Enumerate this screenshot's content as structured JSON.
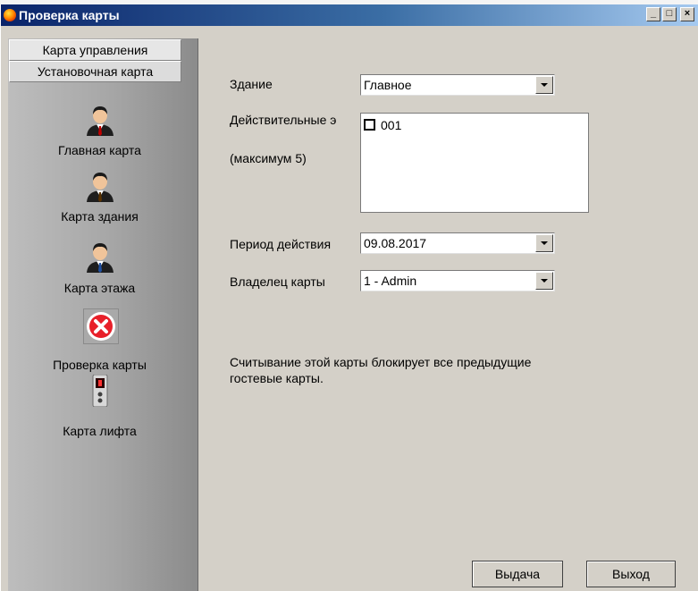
{
  "window": {
    "title": "Проверка карты",
    "minimize": "_",
    "maximize": "□",
    "close": "×"
  },
  "sidebar": {
    "tabs": [
      {
        "label": "Карта управления"
      },
      {
        "label": "Установочная карта"
      }
    ],
    "items": [
      {
        "label": "Главная карта",
        "icon": "person-red-tie-icon",
        "tie_color": "#c00000"
      },
      {
        "label": "Карта здания",
        "icon": "person-brown-tie-icon",
        "tie_color": "#5a3200"
      },
      {
        "label": "Карта этажа",
        "icon": "person-blue-tie-icon",
        "tie_color": "#1f4fa0"
      },
      {
        "label": "Проверка карты",
        "icon": "error-x-icon",
        "selected": true
      },
      {
        "label": "Карта лифта",
        "icon": "elevator-panel-icon"
      }
    ]
  },
  "form": {
    "building_label": "Здание",
    "building_value": "Главное",
    "floors_label": "Действительные э",
    "floors_max": "(максимум 5)",
    "floors": [
      {
        "label": "001",
        "checked": false
      }
    ],
    "period_label": "Период действия",
    "period_value": "09.08.2017",
    "owner_label": "Владелец карты",
    "owner_value": "1 - Admin"
  },
  "info": {
    "line1": "Считывание этой карты блокирует все предыдущие",
    "line2": "гостевые карты."
  },
  "buttons": {
    "issue": "Выдача",
    "exit": "Выход"
  },
  "colors": {
    "titlebar_start": "#0a246a",
    "window_bg": "#d4d0c8",
    "error_red": "#e8202a"
  }
}
